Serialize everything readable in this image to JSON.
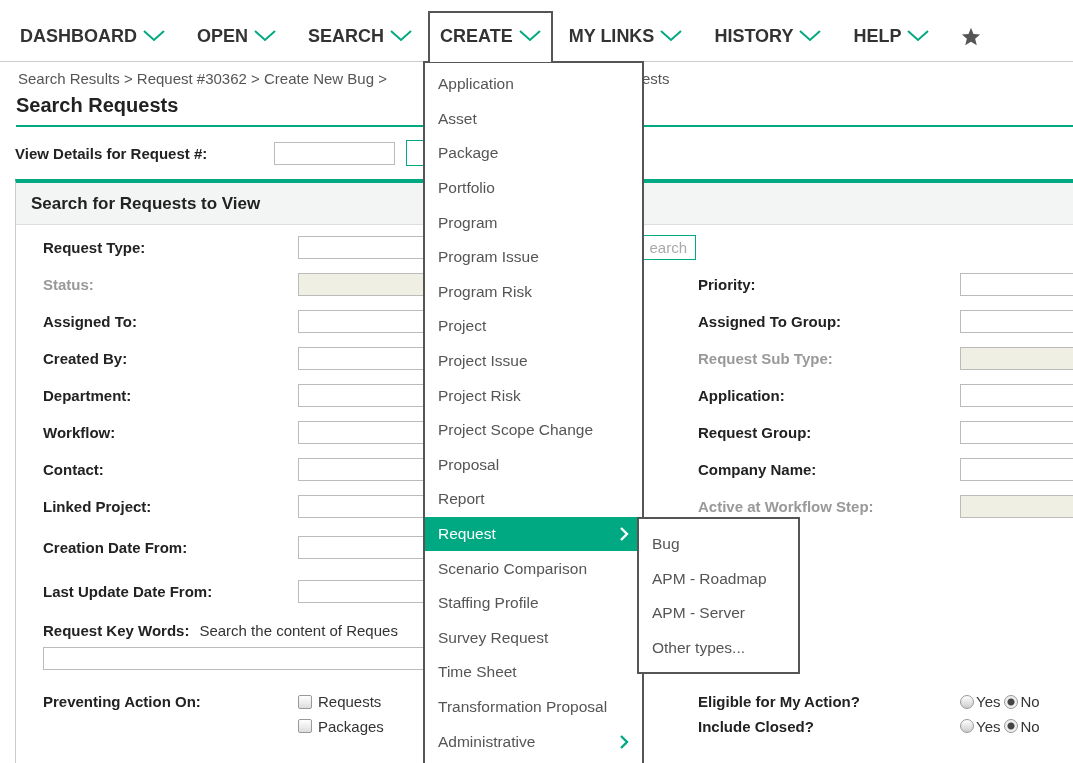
{
  "nav": [
    {
      "label": "DASHBOARD",
      "open": false
    },
    {
      "label": "OPEN",
      "open": false
    },
    {
      "label": "SEARCH",
      "open": false
    },
    {
      "label": "CREATE",
      "open": true
    },
    {
      "label": "MY LINKS",
      "open": false
    },
    {
      "label": "HISTORY",
      "open": false
    },
    {
      "label": "HELP",
      "open": false
    }
  ],
  "breadcrumb": {
    "visible_start": "Search Results > Request #30362 > Create New Bug >",
    "visible_end": "ests"
  },
  "page_title": "Search Requests",
  "view_details": {
    "label": "View Details for Request #:"
  },
  "panel": {
    "title": "Search for Requests to View",
    "search_button": "earch",
    "rows": [
      {
        "left": {
          "label": "Request Type:",
          "disabled": false
        }
      },
      {
        "left": {
          "label": "Status:",
          "disabled": true
        },
        "right": {
          "label": "Priority:",
          "disabled": false
        }
      },
      {
        "left": {
          "label": "Assigned To:",
          "disabled": false
        },
        "right": {
          "label": "Assigned To Group:",
          "disabled": false
        }
      },
      {
        "left": {
          "label": "Created By:",
          "disabled": false
        },
        "right": {
          "label": "Request Sub Type:",
          "disabled": true
        }
      },
      {
        "left": {
          "label": "Department:",
          "disabled": false
        },
        "right": {
          "label": "Application:",
          "disabled": false
        }
      },
      {
        "left": {
          "label": "Workflow:",
          "disabled": false
        },
        "right": {
          "label": "Request Group:",
          "disabled": false
        }
      },
      {
        "left": {
          "label": "Contact:",
          "disabled": false
        },
        "right": {
          "label": "Company Name:",
          "disabled": false
        }
      },
      {
        "left": {
          "label": "Linked Project:",
          "disabled": false
        },
        "right": {
          "label": "Active at Workflow Step:",
          "disabled": true
        }
      },
      {
        "left": {
          "label": "Creation Date From:",
          "disabled": false
        }
      },
      {
        "left": {
          "label": "Last Update Date From:",
          "disabled": false
        }
      }
    ],
    "keywords": {
      "label": "Request Key Words:",
      "hint": "Search the content of Reques"
    },
    "preventing": {
      "label": "Preventing Action On:",
      "options": [
        {
          "label": "Requests",
          "checked": false
        },
        {
          "label": "Packages",
          "checked": false
        }
      ]
    },
    "radios": [
      {
        "label": "Eligible for My Action?",
        "options": [
          {
            "label": "Yes",
            "selected": false
          },
          {
            "label": "No",
            "selected": true
          }
        ]
      },
      {
        "label": "Include Closed?",
        "options": [
          {
            "label": "Yes",
            "selected": false
          },
          {
            "label": "No",
            "selected": true
          }
        ]
      }
    ]
  },
  "create_menu": [
    {
      "label": "Application",
      "selected": false,
      "has_submenu": false
    },
    {
      "label": "Asset",
      "selected": false,
      "has_submenu": false
    },
    {
      "label": "Package",
      "selected": false,
      "has_submenu": false
    },
    {
      "label": "Portfolio",
      "selected": false,
      "has_submenu": false
    },
    {
      "label": "Program",
      "selected": false,
      "has_submenu": false
    },
    {
      "label": "Program Issue",
      "selected": false,
      "has_submenu": false
    },
    {
      "label": "Program Risk",
      "selected": false,
      "has_submenu": false
    },
    {
      "label": "Project",
      "selected": false,
      "has_submenu": false
    },
    {
      "label": "Project Issue",
      "selected": false,
      "has_submenu": false
    },
    {
      "label": "Project Risk",
      "selected": false,
      "has_submenu": false
    },
    {
      "label": "Project Scope Change",
      "selected": false,
      "has_submenu": false
    },
    {
      "label": "Proposal",
      "selected": false,
      "has_submenu": false
    },
    {
      "label": "Report",
      "selected": false,
      "has_submenu": false
    },
    {
      "label": "Request",
      "selected": true,
      "has_submenu": true
    },
    {
      "label": "Scenario Comparison",
      "selected": false,
      "has_submenu": false
    },
    {
      "label": "Staffing Profile",
      "selected": false,
      "has_submenu": false
    },
    {
      "label": "Survey Request",
      "selected": false,
      "has_submenu": false
    },
    {
      "label": "Time Sheet",
      "selected": false,
      "has_submenu": false
    },
    {
      "label": "Transformation Proposal",
      "selected": false,
      "has_submenu": false
    },
    {
      "label": "Administrative",
      "selected": false,
      "has_submenu": true
    }
  ],
  "request_submenu": [
    "Bug",
    "APM - Roadmap",
    "APM - Server",
    "Other types..."
  ]
}
